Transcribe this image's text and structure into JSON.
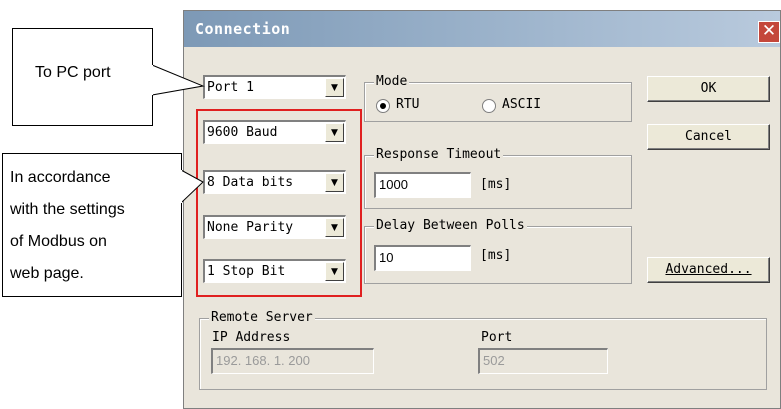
{
  "dialog": {
    "title": "Connection",
    "close_glyph": "✕",
    "port_combo": "Port 1",
    "baud_combo": "9600 Baud",
    "databits_combo": "8 Data bits",
    "parity_combo": "None Parity",
    "stopbit_combo": "1 Stop Bit",
    "mode": {
      "label": "Mode",
      "options": [
        "RTU",
        "ASCII"
      ],
      "selected": "RTU"
    },
    "response_timeout": {
      "label": "Response Timeout",
      "value": "1000",
      "unit": "[ms]"
    },
    "delay_between_polls": {
      "label": "Delay Between Polls",
      "value": "10",
      "unit": "[ms]"
    },
    "buttons": {
      "ok": "OK",
      "cancel": "Cancel",
      "advanced": "Advanced..."
    },
    "remote_server": {
      "label": "Remote Server",
      "ip_label": "IP Address",
      "ip_value": "192. 168. 1. 200",
      "port_label": "Port",
      "port_value": "502"
    }
  },
  "annotations": {
    "pc_port": "To PC port",
    "settings_lines": [
      "In accordance",
      "with the settings",
      "of Modbus on",
      "web page."
    ]
  },
  "colors": {
    "highlight": "#e02020",
    "title_gradient_start": "#7d99b6",
    "close_button": "#c4473b"
  }
}
